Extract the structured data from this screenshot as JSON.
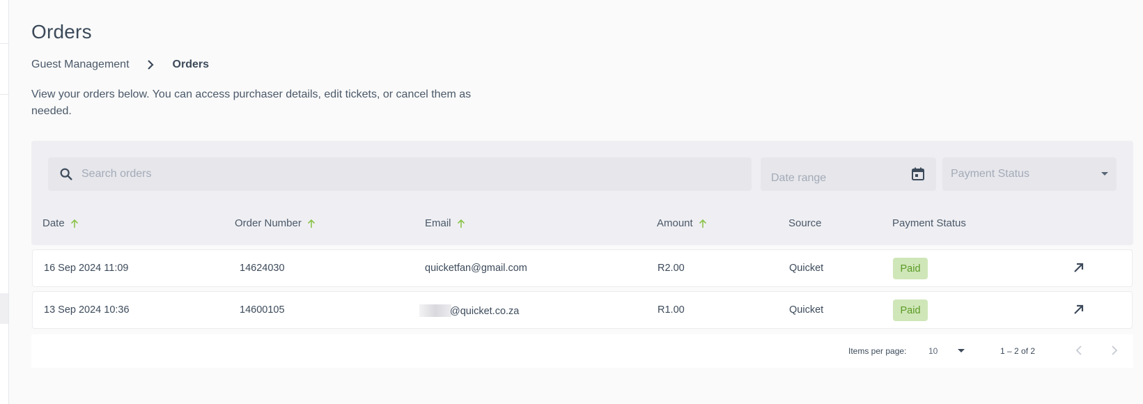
{
  "page": {
    "title": "Orders",
    "breadcrumb": {
      "parent": "Guest Management",
      "current": "Orders"
    },
    "description": "View your orders below. You can access purchaser details, edit tickets, or cancel them as needed."
  },
  "filters": {
    "search_placeholder": "Search orders",
    "date_range_placeholder": "Date range",
    "payment_status_placeholder": "Payment Status"
  },
  "table": {
    "columns": [
      {
        "label": "Date",
        "sortable": true
      },
      {
        "label": "Order Number",
        "sortable": true
      },
      {
        "label": "Email",
        "sortable": true
      },
      {
        "label": "Amount",
        "sortable": true
      },
      {
        "label": "Source",
        "sortable": false
      },
      {
        "label": "Payment Status",
        "sortable": false
      }
    ],
    "rows": [
      {
        "date": "16 Sep 2024 11:09",
        "order_number": "14624030",
        "email": "quicketfan@gmail.com",
        "amount": "R2.00",
        "source": "Quicket",
        "status": "Paid"
      },
      {
        "date": "13 Sep 2024 10:36",
        "order_number": "14600105",
        "email": "@quicket.co.za",
        "amount": "R1.00",
        "source": "Quicket",
        "status": "Paid"
      }
    ]
  },
  "pagination": {
    "items_per_page_label": "Items per page:",
    "items_per_page_value": "10",
    "range_label": "1 – 2 of 2"
  },
  "colors": {
    "sort_arrow": "#8bc34a",
    "paid_badge_bg": "#cfe6b8",
    "paid_badge_text": "#5a9a25"
  },
  "icons": {
    "search": "search-icon",
    "calendar": "calendar-icon",
    "breadcrumb_separator": "chevron-right-icon",
    "sort": "arrow-up-icon",
    "open_order": "arrow-north-east-icon",
    "prev_page": "chevron-left-icon",
    "next_page": "chevron-right-icon"
  }
}
